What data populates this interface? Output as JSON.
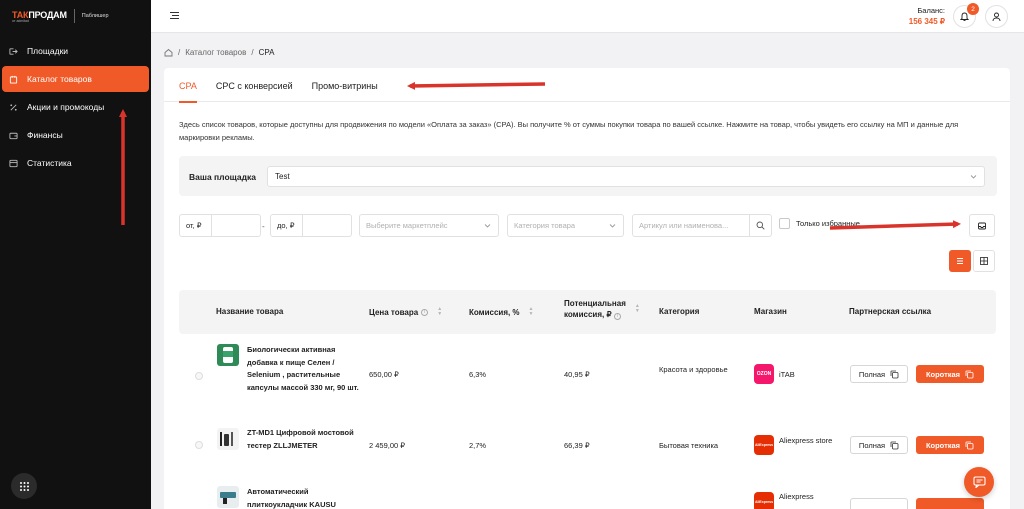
{
  "brand": {
    "logo_prefix": "ТАК",
    "logo_main": "ПРОДАМ",
    "logo_sub": "от admitad",
    "section": "Паблишер"
  },
  "sidebar": {
    "items": [
      {
        "label": "Площадки",
        "icon": "sign-in-icon",
        "active": false
      },
      {
        "label": "Каталог товаров",
        "icon": "box-icon",
        "active": true
      },
      {
        "label": "Акции и промокоды",
        "icon": "percent-icon",
        "active": false
      },
      {
        "label": "Финансы",
        "icon": "wallet-icon",
        "active": false
      },
      {
        "label": "Статистика",
        "icon": "chart-icon",
        "active": false
      }
    ]
  },
  "header": {
    "balance_label": "Баланс:",
    "balance_value": "156 345 ₽",
    "notifications_count": "2"
  },
  "breadcrumb": {
    "items": [
      "Каталог товаров",
      "CPA"
    ]
  },
  "tabs": [
    {
      "label": "CPA",
      "active": true
    },
    {
      "label": "CPC с конверсией",
      "active": false
    },
    {
      "label": "Промо-витрины",
      "active": false
    }
  ],
  "description": "Здесь список товаров, которые доступны для продвижения по модели «Оплата за заказ» (CPA). Вы получите % от суммы покупки товара по вашей ссылке. Нажмите на товар, чтобы увидеть его ссылку на МП и данные для маркировки рекламы.",
  "platform": {
    "label": "Ваша площадка",
    "value": "Test"
  },
  "filters": {
    "price_from_label": "от, ₽",
    "range_separator": "-",
    "price_to_label": "до, ₽",
    "marketplace_placeholder": "Выберите маркетплейс",
    "category_placeholder": "Категория товара",
    "search_placeholder": "Артикул или наименова...",
    "favorites_label": "Только избранные"
  },
  "table": {
    "headers": {
      "name": "Название товара",
      "price": "Цена товара",
      "commission": "Комиссия, %",
      "potential_line1": "Потенциальная",
      "potential_line2": "комиссия, ₽",
      "category": "Категория",
      "store": "Магазин",
      "link": "Партнерская ссылка"
    },
    "rows": [
      {
        "name": "Биологически активная добавка к пище Селен / Selenium , растительные капсулы массой 330 мг, 90 шт.",
        "price": "650,00 ₽",
        "commission": "6,3%",
        "potential": "40,95 ₽",
        "category": "Красота и здоровье",
        "store": "iTAB",
        "store_logo": "OZON"
      },
      {
        "name": "ZT-MD1 Цифровой мостовой тестер ZLLJMETER",
        "price": "2 459,00 ₽",
        "commission": "2,7%",
        "potential": "66,39 ₽",
        "category": "Бытовая техника",
        "store": "Aliexpress store",
        "store_logo": "AliExpress"
      },
      {
        "name": "Автоматический плиткоукладчик KAUSU",
        "price": "",
        "commission": "",
        "potential": "",
        "category": "",
        "store": "Aliexpress",
        "store_logo": "AliExpress"
      }
    ],
    "btn_full": "Полная",
    "btn_short": "Короткая"
  },
  "colors": {
    "accent": "#f05a28",
    "sidebar_bg": "#111111",
    "arrow": "#d9342b"
  }
}
